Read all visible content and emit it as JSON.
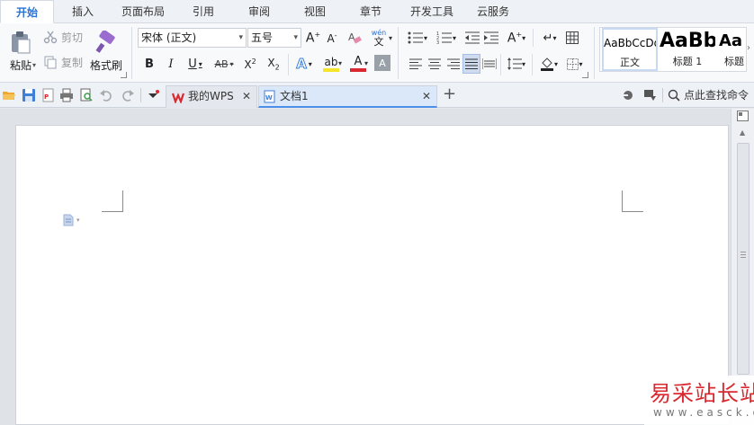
{
  "tabs": [
    "开始",
    "插入",
    "页面布局",
    "引用",
    "审阅",
    "视图",
    "章节",
    "开发工具",
    "云服务"
  ],
  "active_tab": "开始",
  "clipboard": {
    "paste": "粘贴",
    "cut": "剪切",
    "copy": "复制",
    "format_painter": "格式刷"
  },
  "font": {
    "name": "宋体 (正文)",
    "size": "五号",
    "wen_label": "wén"
  },
  "styles": [
    {
      "sample": "AaBbCcDd",
      "name": "正文"
    },
    {
      "sample": "AaBb",
      "name": "标题 1"
    },
    {
      "sample": "Aa",
      "name": "标题"
    }
  ],
  "doc_tabs": [
    {
      "label": "我的WPS"
    },
    {
      "label": "文档1"
    }
  ],
  "search_command": "点此查找命令",
  "watermark": {
    "title": "易采站长站",
    "subtitle": "www.easck.com"
  },
  "colors": {
    "accent": "#2a72d6",
    "tab_active_text": "#2a72d6",
    "highlight": "#f5e52a",
    "font_color": "#d9282f",
    "wps_red": "#d9282f"
  }
}
